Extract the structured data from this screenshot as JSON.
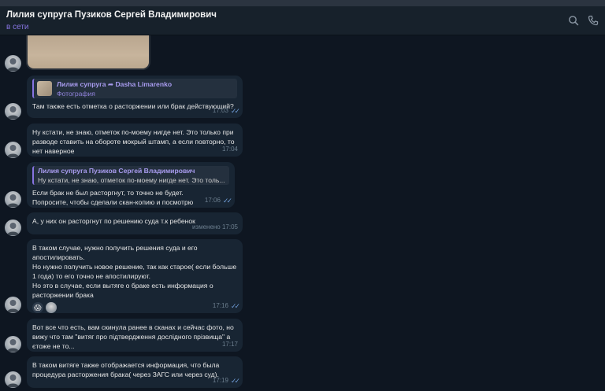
{
  "header": {
    "title": "Лилия супруга Пузиков Сергей Владимирович",
    "status": "в сети"
  },
  "messages": [
    {
      "quote_name": "Лилия супруга ➦ Dasha Limarenko",
      "quote_sub": "Фотография",
      "text": "Там также есть отметка о расторжении или брак действующий?",
      "time": "17:03"
    },
    {
      "text": "Ну кстати, не знаю, отметок по-моему нигде нет. Это только при\nразводе ставить на обороте мокрый штамп, а если повторно, то\nнет наверное",
      "time": "17:04"
    },
    {
      "quote_name": "Лилия супруга Пузиков Сергей Владимирович",
      "quote_text": "Ну кстати, не знаю, отметок по-моему нигде нет. Это толь...",
      "text": "Если брак не был расторгнут, то точно не будет.\nПопросите, чтобы сделали скан-копию и посмотрю",
      "time": "17:06"
    },
    {
      "text": "А, у них он расторгнут по решению суда т.к ребенок",
      "time": "изменено 17:05"
    },
    {
      "text": "В таком случае, нужно получить решения суда и его\nапостилировать.\nНо нужно получить новое решение, так как старое( если больше\n1 года) то его точно не апостилируют.\nНо это в случае, если вытяге о браке есть информация о\nрасторжении брака",
      "reaction": "😱",
      "time": "17:16"
    },
    {
      "text": "Вот все что есть, вам скинула ранее в сканах и сейчас фото, но\nвижу что там \"витяг про підтвердження дослідного прізвища\" а\nєтоже не то...",
      "time": "17:17"
    },
    {
      "text": "В таком витяге также отображается информация, что была\nпроцедура расторжения брака( через ЗАГС или через суд).",
      "time": "17:19"
    }
  ],
  "colors": {
    "background": "#0e1621",
    "bubble": "#182533",
    "accent": "#8774e1",
    "ticks": "#6e9bd4"
  }
}
